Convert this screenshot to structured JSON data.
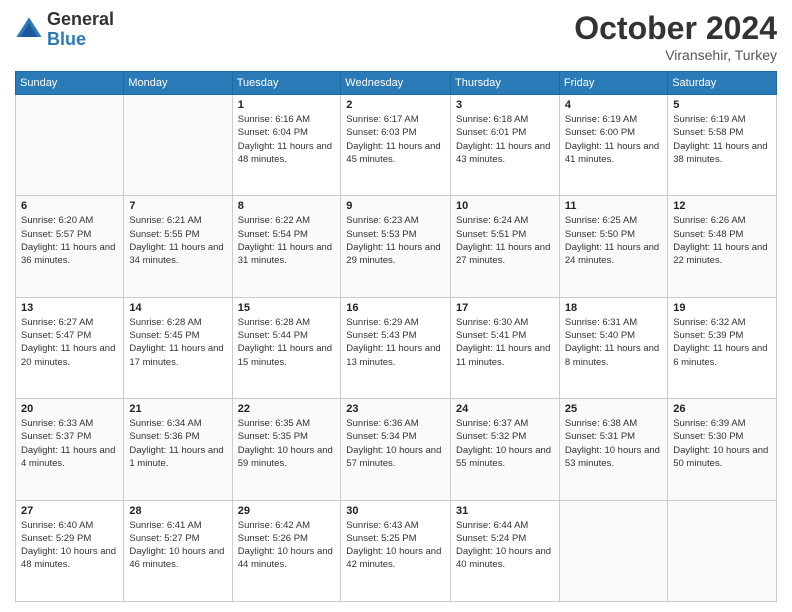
{
  "logo": {
    "general": "General",
    "blue": "Blue"
  },
  "title": "October 2024",
  "location": "Viransehir, Turkey",
  "weekdays": [
    "Sunday",
    "Monday",
    "Tuesday",
    "Wednesday",
    "Thursday",
    "Friday",
    "Saturday"
  ],
  "weeks": [
    [
      {
        "day": "",
        "empty": true
      },
      {
        "day": "",
        "empty": true
      },
      {
        "day": "1",
        "sunrise": "6:16 AM",
        "sunset": "6:04 PM",
        "daylight": "11 hours and 48 minutes."
      },
      {
        "day": "2",
        "sunrise": "6:17 AM",
        "sunset": "6:03 PM",
        "daylight": "11 hours and 45 minutes."
      },
      {
        "day": "3",
        "sunrise": "6:18 AM",
        "sunset": "6:01 PM",
        "daylight": "11 hours and 43 minutes."
      },
      {
        "day": "4",
        "sunrise": "6:19 AM",
        "sunset": "6:00 PM",
        "daylight": "11 hours and 41 minutes."
      },
      {
        "day": "5",
        "sunrise": "6:19 AM",
        "sunset": "5:58 PM",
        "daylight": "11 hours and 38 minutes."
      }
    ],
    [
      {
        "day": "6",
        "sunrise": "6:20 AM",
        "sunset": "5:57 PM",
        "daylight": "11 hours and 36 minutes."
      },
      {
        "day": "7",
        "sunrise": "6:21 AM",
        "sunset": "5:55 PM",
        "daylight": "11 hours and 34 minutes."
      },
      {
        "day": "8",
        "sunrise": "6:22 AM",
        "sunset": "5:54 PM",
        "daylight": "11 hours and 31 minutes."
      },
      {
        "day": "9",
        "sunrise": "6:23 AM",
        "sunset": "5:53 PM",
        "daylight": "11 hours and 29 minutes."
      },
      {
        "day": "10",
        "sunrise": "6:24 AM",
        "sunset": "5:51 PM",
        "daylight": "11 hours and 27 minutes."
      },
      {
        "day": "11",
        "sunrise": "6:25 AM",
        "sunset": "5:50 PM",
        "daylight": "11 hours and 24 minutes."
      },
      {
        "day": "12",
        "sunrise": "6:26 AM",
        "sunset": "5:48 PM",
        "daylight": "11 hours and 22 minutes."
      }
    ],
    [
      {
        "day": "13",
        "sunrise": "6:27 AM",
        "sunset": "5:47 PM",
        "daylight": "11 hours and 20 minutes."
      },
      {
        "day": "14",
        "sunrise": "6:28 AM",
        "sunset": "5:45 PM",
        "daylight": "11 hours and 17 minutes."
      },
      {
        "day": "15",
        "sunrise": "6:28 AM",
        "sunset": "5:44 PM",
        "daylight": "11 hours and 15 minutes."
      },
      {
        "day": "16",
        "sunrise": "6:29 AM",
        "sunset": "5:43 PM",
        "daylight": "11 hours and 13 minutes."
      },
      {
        "day": "17",
        "sunrise": "6:30 AM",
        "sunset": "5:41 PM",
        "daylight": "11 hours and 11 minutes."
      },
      {
        "day": "18",
        "sunrise": "6:31 AM",
        "sunset": "5:40 PM",
        "daylight": "11 hours and 8 minutes."
      },
      {
        "day": "19",
        "sunrise": "6:32 AM",
        "sunset": "5:39 PM",
        "daylight": "11 hours and 6 minutes."
      }
    ],
    [
      {
        "day": "20",
        "sunrise": "6:33 AM",
        "sunset": "5:37 PM",
        "daylight": "11 hours and 4 minutes."
      },
      {
        "day": "21",
        "sunrise": "6:34 AM",
        "sunset": "5:36 PM",
        "daylight": "11 hours and 1 minute."
      },
      {
        "day": "22",
        "sunrise": "6:35 AM",
        "sunset": "5:35 PM",
        "daylight": "10 hours and 59 minutes."
      },
      {
        "day": "23",
        "sunrise": "6:36 AM",
        "sunset": "5:34 PM",
        "daylight": "10 hours and 57 minutes."
      },
      {
        "day": "24",
        "sunrise": "6:37 AM",
        "sunset": "5:32 PM",
        "daylight": "10 hours and 55 minutes."
      },
      {
        "day": "25",
        "sunrise": "6:38 AM",
        "sunset": "5:31 PM",
        "daylight": "10 hours and 53 minutes."
      },
      {
        "day": "26",
        "sunrise": "6:39 AM",
        "sunset": "5:30 PM",
        "daylight": "10 hours and 50 minutes."
      }
    ],
    [
      {
        "day": "27",
        "sunrise": "6:40 AM",
        "sunset": "5:29 PM",
        "daylight": "10 hours and 48 minutes."
      },
      {
        "day": "28",
        "sunrise": "6:41 AM",
        "sunset": "5:27 PM",
        "daylight": "10 hours and 46 minutes."
      },
      {
        "day": "29",
        "sunrise": "6:42 AM",
        "sunset": "5:26 PM",
        "daylight": "10 hours and 44 minutes."
      },
      {
        "day": "30",
        "sunrise": "6:43 AM",
        "sunset": "5:25 PM",
        "daylight": "10 hours and 42 minutes."
      },
      {
        "day": "31",
        "sunrise": "6:44 AM",
        "sunset": "5:24 PM",
        "daylight": "10 hours and 40 minutes."
      },
      {
        "day": "",
        "empty": true
      },
      {
        "day": "",
        "empty": true
      }
    ]
  ]
}
